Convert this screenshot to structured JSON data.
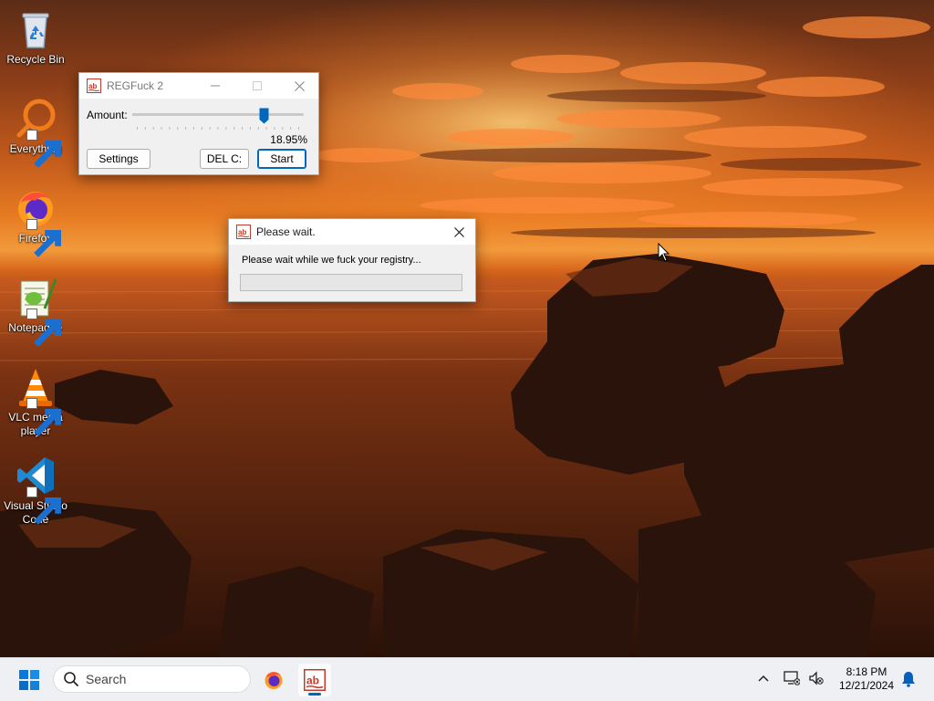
{
  "desktop": {
    "icons": [
      {
        "label": "Recycle Bin",
        "icon": "recycle-bin-icon"
      },
      {
        "label": "Everything",
        "icon": "everything-search-icon"
      },
      {
        "label": "Firefox",
        "icon": "firefox-icon"
      },
      {
        "label": "Notepad++",
        "icon": "notepad-plus-plus-icon"
      },
      {
        "label": "VLC media player",
        "icon": "vlc-icon"
      },
      {
        "label": "Visual Studio Code",
        "icon": "vscode-icon"
      }
    ]
  },
  "main_window": {
    "title": "REGFuck 2",
    "amount_label": "Amount:",
    "slider_value_fraction": 0.785,
    "percent_text": "18.95%",
    "settings_label": "Settings",
    "delc_label": "DEL C:",
    "start_label": "Start"
  },
  "wait_dialog": {
    "title": "Please wait.",
    "message": "Please wait while we fuck your registry...",
    "progress_fraction": 0
  },
  "taskbar": {
    "search_placeholder": "Search",
    "time": "8:18 PM",
    "date": "12/21/2024"
  },
  "colors": {
    "accent": "#0067c0",
    "window_bg": "#f0f0f0",
    "taskbar_bg": "#eef0f3"
  }
}
